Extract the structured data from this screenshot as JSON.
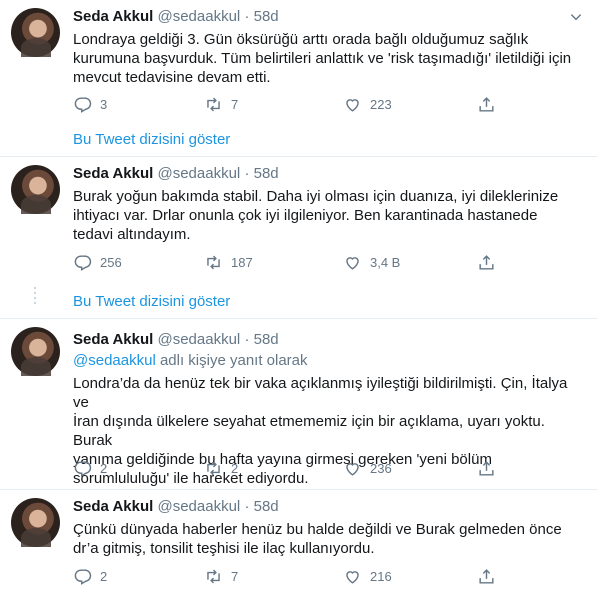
{
  "tweets": [
    {
      "name": "Seda Akkul",
      "handle": "@sedaakkul",
      "time": "58d",
      "reply_prefix": "",
      "reply_handle": "",
      "reply_suffix": "",
      "lines": [
        "Londraya geldiği 3. Gün öksürüğü arttı orada bağlı olduğumuz sağlık",
        "kurumuna başvurduk. Tüm belirtileri anlattık ve 'risk taşımadığı'  iletildiği için",
        "mevcut tedavisine devam etti."
      ],
      "replies": "3",
      "retweets": "7",
      "likes": "223",
      "thread_link": "Bu Tweet dizisini göster"
    },
    {
      "name": "Seda Akkul",
      "handle": "@sedaakkul",
      "time": "58d",
      "reply_prefix": "",
      "reply_handle": "",
      "reply_suffix": "",
      "lines": [
        "Burak yoğun bakımda stabil. Daha iyi olması için duanıza, iyi dileklerinize",
        "ihtiyacı var.  Drlar onunla çok iyi ilgileniyor. Ben karantinada hastanede",
        "tedavi altındayım."
      ],
      "replies": "256",
      "retweets": "187",
      "likes": "3,4 B",
      "thread_link": "Bu Tweet dizisini göster"
    },
    {
      "name": "Seda Akkul",
      "handle": "@sedaakkul",
      "time": "58d",
      "reply_prefix": "",
      "reply_handle": "@sedaakkul",
      "reply_suffix": " adlı kişiye yanıt olarak",
      "lines": [
        "Londra’da da henüz tek bir vaka açıklanmış iyileştiği bildirilmişti. Çin, İtalya ve",
        "İran dışında ülkelere seyahat etmememiz için bir açıklama, uyarı yoktu. Burak",
        "yanıma geldiğinde bu hafta yayına girmesi gereken 'yeni bölüm",
        "sorumlululuğu' ile hareket ediyordu."
      ],
      "replies": "2",
      "retweets": "2",
      "likes": "236",
      "thread_link": ""
    },
    {
      "name": "Seda Akkul",
      "handle": "@sedaakkul",
      "time": "58d",
      "reply_prefix": "",
      "reply_handle": "",
      "reply_suffix": "",
      "lines": [
        "Çünkü dünyada haberler henüz bu halde değildi ve Burak gelmeden önce",
        "dr’a gitmiş, tonsilit teşhisi ile ilaç kullanıyordu."
      ],
      "replies": "2",
      "retweets": "7",
      "likes": "216",
      "thread_link": ""
    }
  ],
  "colors": {
    "text": "#14171a",
    "muted": "#657786",
    "link": "#1b95e0",
    "divider": "#e6ecf0"
  },
  "icons": [
    "reply-icon",
    "retweet-icon",
    "like-icon",
    "share-icon",
    "chevron-down-icon"
  ]
}
